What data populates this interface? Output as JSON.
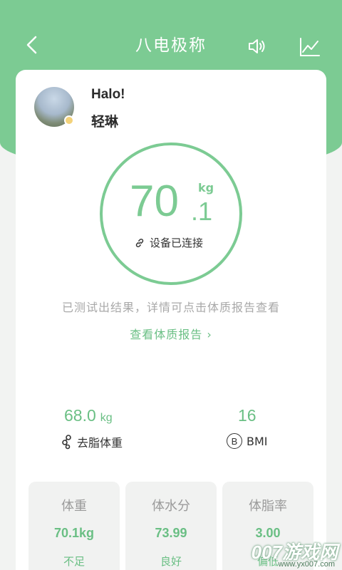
{
  "header": {
    "title": "八电极称"
  },
  "user": {
    "greeting": "Halo!",
    "name": "轻琳"
  },
  "measurement": {
    "weight_int": "70",
    "weight_dec": ".1",
    "unit": "kg",
    "device_status": "设备已连接"
  },
  "result": {
    "message": "已测试出结果，详情可点击体质报告查看",
    "report_link": "查看体质报告 ›"
  },
  "summary": {
    "fat_free_weight": "68.0",
    "fat_free_unit": "kg",
    "fat_free_label": "去脂体重",
    "bmi_value": "16",
    "bmi_badge": "B",
    "bmi_label": "BMI"
  },
  "stats": [
    {
      "label": "体重",
      "value": "70.1kg",
      "status": "不足"
    },
    {
      "label": "体水分",
      "value": "73.99",
      "status": "良好"
    },
    {
      "label": "体脂率",
      "value": "3.00",
      "status": "偏低"
    }
  ],
  "watermark": {
    "text": "007游戏网",
    "url": "www.yx007.com"
  },
  "colors": {
    "accent": "#7ccb93",
    "text_green": "#6abf84"
  }
}
